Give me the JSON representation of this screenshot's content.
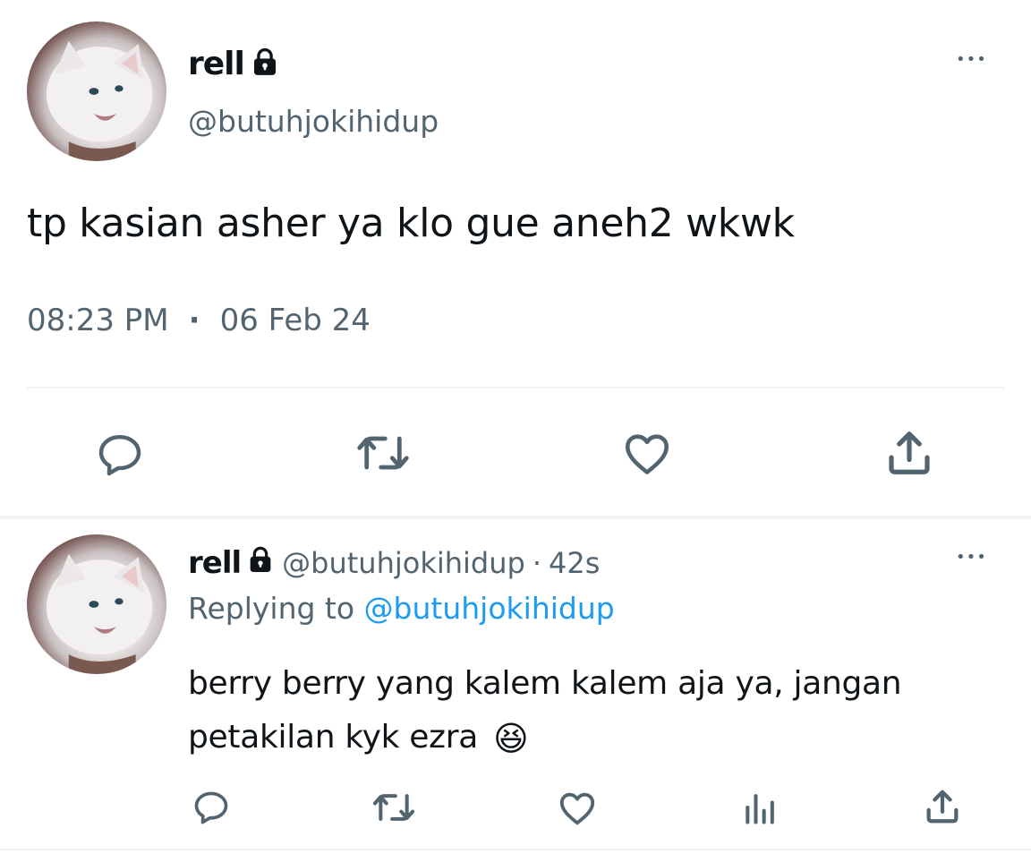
{
  "main_tweet": {
    "display_name": "rell",
    "handle": "@butuhjokihidup",
    "text": "tp kasian asher ya klo gue aneh2 wkwk",
    "time": "08:23 PM",
    "separator": "·",
    "date": "06 Feb 24",
    "more_label": "•••"
  },
  "reply_tweet": {
    "display_name": "rell",
    "handle": "@butuhjokihidup",
    "separator": "·",
    "age": "42s",
    "replying_prefix": "Replying to",
    "replying_handle": "@butuhjokihidup",
    "text_line1": "berry berry yang kalem kalem aja ya, jangan",
    "text_line2": "petakilan kyk ezra",
    "emoji": "😆",
    "more_label": "•••"
  },
  "icons": {
    "lock": "lock-icon",
    "reply": "reply-icon",
    "retweet": "retweet-icon",
    "like": "heart-icon",
    "views": "analytics-icon",
    "share": "share-icon"
  },
  "colors": {
    "text": "#0f1419",
    "muted": "#536471",
    "link": "#1d9bf0",
    "divider": "#eff3f4"
  }
}
